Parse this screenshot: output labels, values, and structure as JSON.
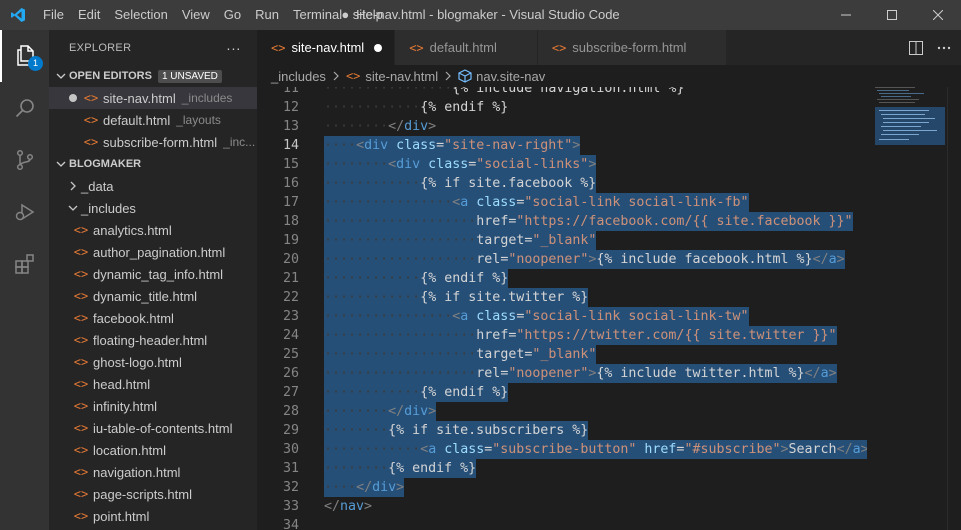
{
  "window": {
    "title": "● site-nav.html - blogmaker - Visual Studio Code",
    "menu": [
      "File",
      "Edit",
      "Selection",
      "View",
      "Go",
      "Run",
      "Terminal",
      "Help"
    ]
  },
  "activity": {
    "explorer_badge": "1"
  },
  "sidebar": {
    "header": "EXPLORER",
    "more_label": "···",
    "open_editors": {
      "label": "OPEN EDITORS",
      "badge": "1 UNSAVED",
      "items": [
        {
          "name": "site-nav.html",
          "folder": "_includes",
          "unsaved": true
        },
        {
          "name": "default.html",
          "folder": "_layouts",
          "unsaved": false
        },
        {
          "name": "subscribe-form.html",
          "folder": "_inc...",
          "unsaved": false
        }
      ]
    },
    "project": {
      "label": "BLOGMAKER",
      "folders": [
        "_data",
        "_includes"
      ],
      "files": [
        "analytics.html",
        "author_pagination.html",
        "dynamic_tag_info.html",
        "dynamic_title.html",
        "facebook.html",
        "floating-header.html",
        "ghost-logo.html",
        "head.html",
        "infinity.html",
        "iu-table-of-contents.html",
        "location.html",
        "navigation.html",
        "page-scripts.html",
        "point.html"
      ]
    }
  },
  "tabs": [
    {
      "label": "site-nav.html",
      "active": true,
      "unsaved": true
    },
    {
      "label": "default.html",
      "active": false,
      "unsaved": false
    },
    {
      "label": "subscribe-form.html",
      "active": false,
      "unsaved": false
    }
  ],
  "breadcrumb": {
    "folder": "_includes",
    "file": "site-nav.html",
    "symbol": "nav.site-nav"
  },
  "editor": {
    "current_line": 14,
    "lines": [
      {
        "n": 11,
        "sel": false,
        "text": "                {% include navigation.html %}"
      },
      {
        "n": 12,
        "sel": false,
        "text": "            {% endif %}"
      },
      {
        "n": 13,
        "sel": false,
        "text": "        </div>"
      },
      {
        "n": 14,
        "sel": true,
        "text": "    <div class=\"site-nav-right\">"
      },
      {
        "n": 15,
        "sel": true,
        "text": "        <div class=\"social-links\">"
      },
      {
        "n": 16,
        "sel": true,
        "text": "            {% if site.facebook %}"
      },
      {
        "n": 17,
        "sel": true,
        "text": "                <a class=\"social-link social-link-fb\""
      },
      {
        "n": 18,
        "sel": true,
        "text": "                   href=\"https://facebook.com/{{ site.facebook }}\""
      },
      {
        "n": 19,
        "sel": true,
        "text": "                   target=\"_blank\""
      },
      {
        "n": 20,
        "sel": true,
        "text": "                   rel=\"noopener\">{% include facebook.html %}</a>"
      },
      {
        "n": 21,
        "sel": true,
        "text": "            {% endif %}"
      },
      {
        "n": 22,
        "sel": true,
        "text": "            {% if site.twitter %}"
      },
      {
        "n": 23,
        "sel": true,
        "text": "                <a class=\"social-link social-link-tw\""
      },
      {
        "n": 24,
        "sel": true,
        "text": "                   href=\"https://twitter.com/{{ site.twitter }}\""
      },
      {
        "n": 25,
        "sel": true,
        "text": "                   target=\"_blank\""
      },
      {
        "n": 26,
        "sel": true,
        "text": "                   rel=\"noopener\">{% include twitter.html %}</a>"
      },
      {
        "n": 27,
        "sel": true,
        "text": "            {% endif %}"
      },
      {
        "n": 28,
        "sel": true,
        "text": "        </div>"
      },
      {
        "n": 29,
        "sel": true,
        "text": "        {% if site.subscribers %}"
      },
      {
        "n": 30,
        "sel": true,
        "text": "            <a class=\"subscribe-button\" href=\"#subscribe\">Search</a>"
      },
      {
        "n": 31,
        "sel": true,
        "text": "        {% endif %}"
      },
      {
        "n": 32,
        "sel": true,
        "text": "    </div>"
      },
      {
        "n": 33,
        "sel": false,
        "text": "</nav>"
      },
      {
        "n": 34,
        "sel": false,
        "text": ""
      }
    ]
  },
  "colors": {
    "accent": "#007acc",
    "selection": "#264f78",
    "html_icon": "#e37933"
  }
}
